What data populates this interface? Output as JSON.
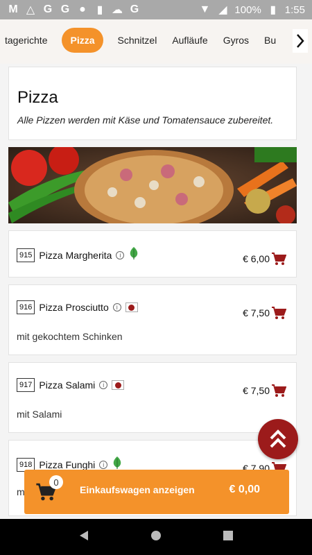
{
  "status": {
    "battery": "100%",
    "time": "1:55"
  },
  "categories": [
    "tagerichte",
    "Pizza",
    "Schnitzel",
    "Aufläufe",
    "Gyros",
    "Bu"
  ],
  "section": {
    "title": "Pizza",
    "subtitle": "Alle Pizzen werden mit Käse und Tomatensauce zubereitet."
  },
  "items": [
    {
      "num": "915",
      "name": "Pizza Margherita",
      "price": "€ 6,00",
      "desc": "",
      "tag": "leaf-icon"
    },
    {
      "num": "916",
      "name": "Pizza Prosciutto",
      "price": "€ 7,50",
      "desc": "mit gekochtem Schinken",
      "tag": "meat-icon"
    },
    {
      "num": "917",
      "name": "Pizza Salami",
      "price": "€ 7,50",
      "desc": "mit Salami",
      "tag": "meat-icon"
    },
    {
      "num": "918",
      "name": "Pizza Funghi",
      "price": "€ 7,90",
      "desc": "m",
      "tag": "leaf-icon"
    }
  ],
  "cart": {
    "count": "0",
    "label": "Einkaufswagen anzeigen",
    "total": "€ 0,00"
  },
  "colors": {
    "accent": "#f4922a",
    "dark_red": "#9c1b1b"
  }
}
